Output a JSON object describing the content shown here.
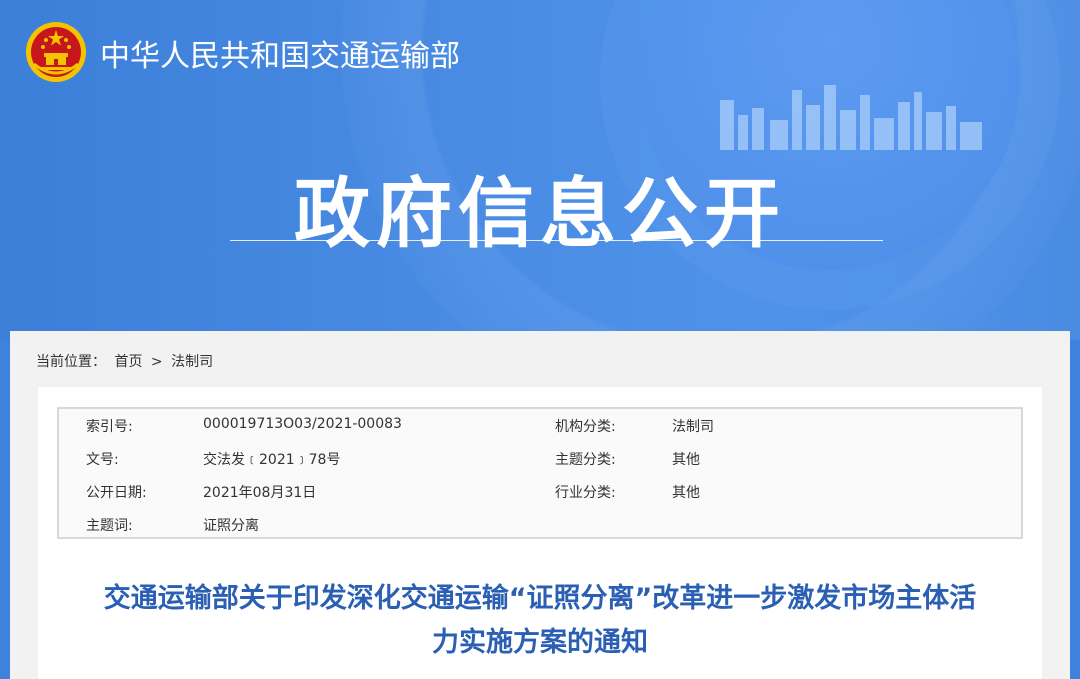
{
  "header": {
    "site_name": "中华人民共和国交通运输部",
    "section_title": "政府信息公开"
  },
  "breadcrumb": {
    "label": "当前位置：",
    "home": "首页",
    "separator": ">",
    "current": "法制司"
  },
  "meta": {
    "index_no_label": "索引号:",
    "index_no": "000019713O03/2021-00083",
    "org_label": "机构分类:",
    "org": "法制司",
    "doc_no_label": "文号:",
    "doc_no": "交法发﹝2021﹞78号",
    "topic_label": "主题分类:",
    "topic": "其他",
    "date_label": "公开日期:",
    "date": "2021年08月31日",
    "industry_label": "行业分类:",
    "industry": "其他",
    "keywords_label": "主题词:",
    "keywords": "证照分离"
  },
  "document": {
    "title_line1": "交通运输部关于印发深化交通运输“证照分离”改革进一步激发市场主体活",
    "title_line2": "力实施方案的通知"
  },
  "colors": {
    "banner_blue": "#3f82dc",
    "title_blue": "#2a5fb3",
    "emblem_red": "#c8161d",
    "emblem_gold": "#f5c400"
  }
}
